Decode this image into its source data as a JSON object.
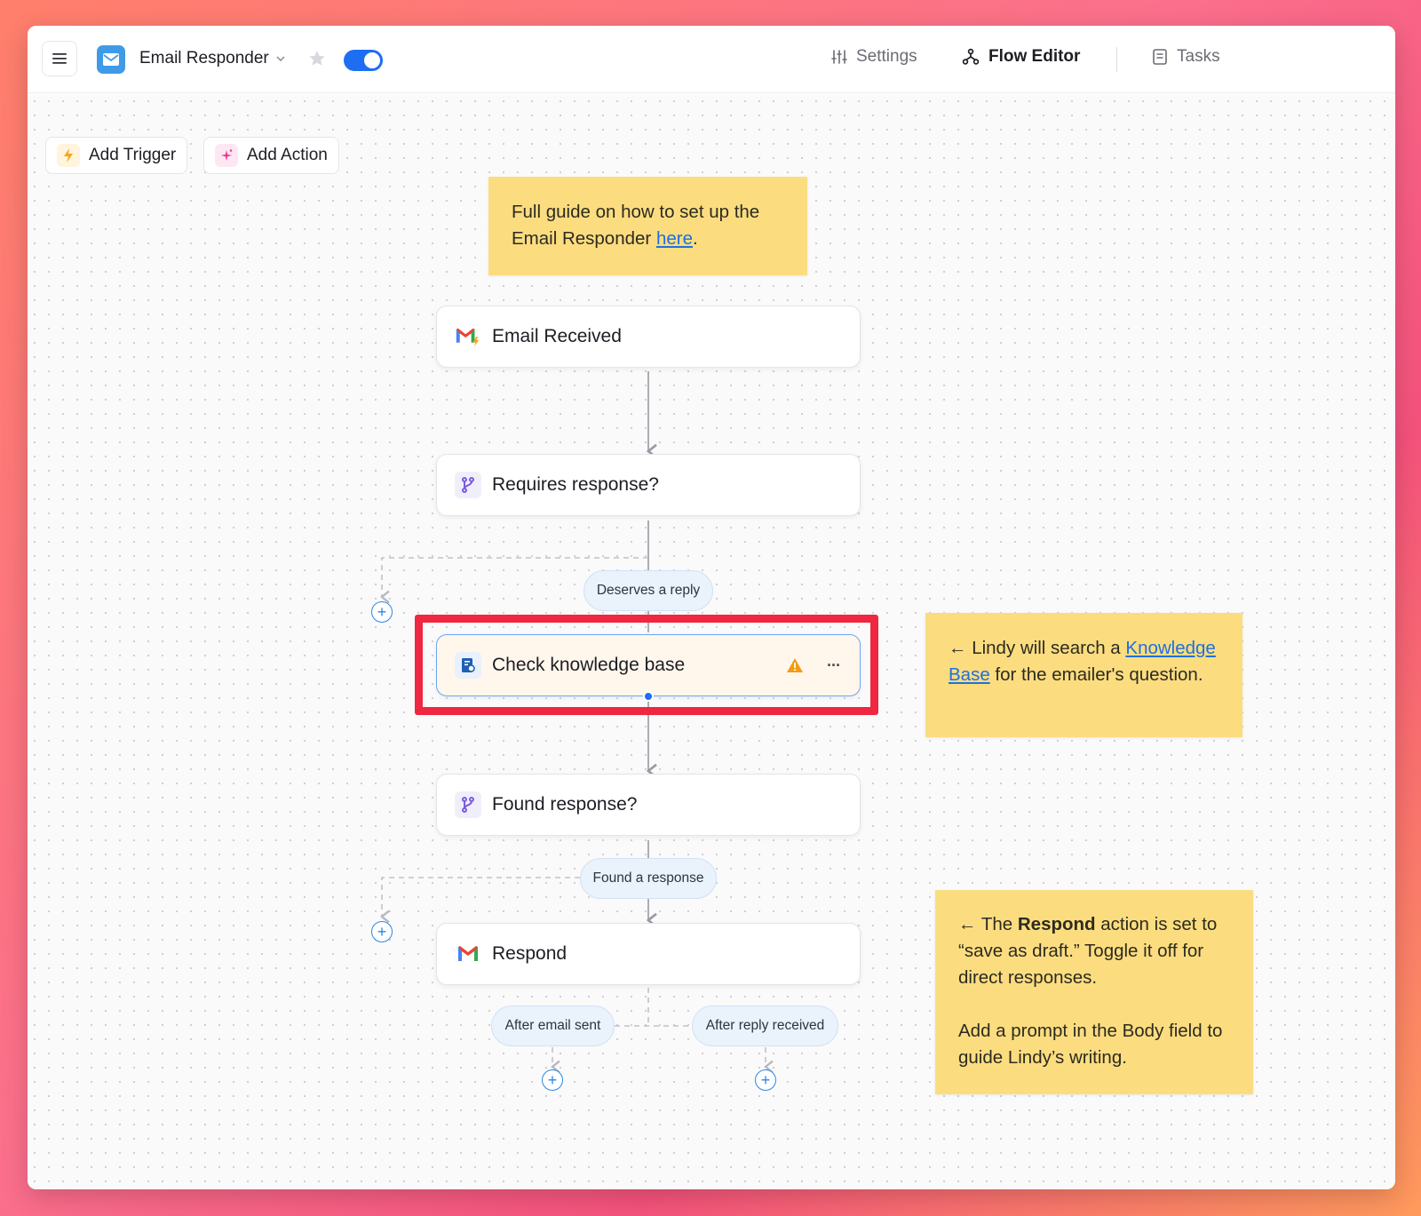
{
  "header": {
    "app_title": "Email Responder",
    "nav": {
      "settings": "Settings",
      "flow_editor": "Flow Editor",
      "tasks": "Tasks"
    }
  },
  "toolbar": {
    "add_trigger": "Add Trigger",
    "add_action": "Add Action"
  },
  "notes": {
    "guide": {
      "text_before": "Full guide on how to set up the Email Responder ",
      "link": "here",
      "text_after": "."
    },
    "knowledge": {
      "prefix": "← Lindy will search a ",
      "link": "Knowledge Base",
      "suffix": " for the emailer's question."
    },
    "respond": {
      "prefix": "← The ",
      "bold": "Respond",
      "suffix": " action is set to “save as draft.” Toggle it off for direct responses.",
      "para2": "Add a prompt in the Body field to guide Lindy’s writing."
    }
  },
  "flow": {
    "nodes": {
      "email_received": "Email Received",
      "requires_response": "Requires response?",
      "check_knowledge": "Check knowledge base",
      "found_response": "Found response?",
      "respond": "Respond"
    },
    "branches": {
      "deserves_reply": "Deserves a reply",
      "found_a_response": "Found a response",
      "after_email_sent": "After email sent",
      "after_reply_received": "After reply received"
    },
    "more_menu": "···"
  },
  "colors": {
    "accent": "#1d6ef2",
    "note_yellow": "#fbdd80",
    "highlight_red": "#ef2740",
    "warning_orange": "#f39c12"
  }
}
